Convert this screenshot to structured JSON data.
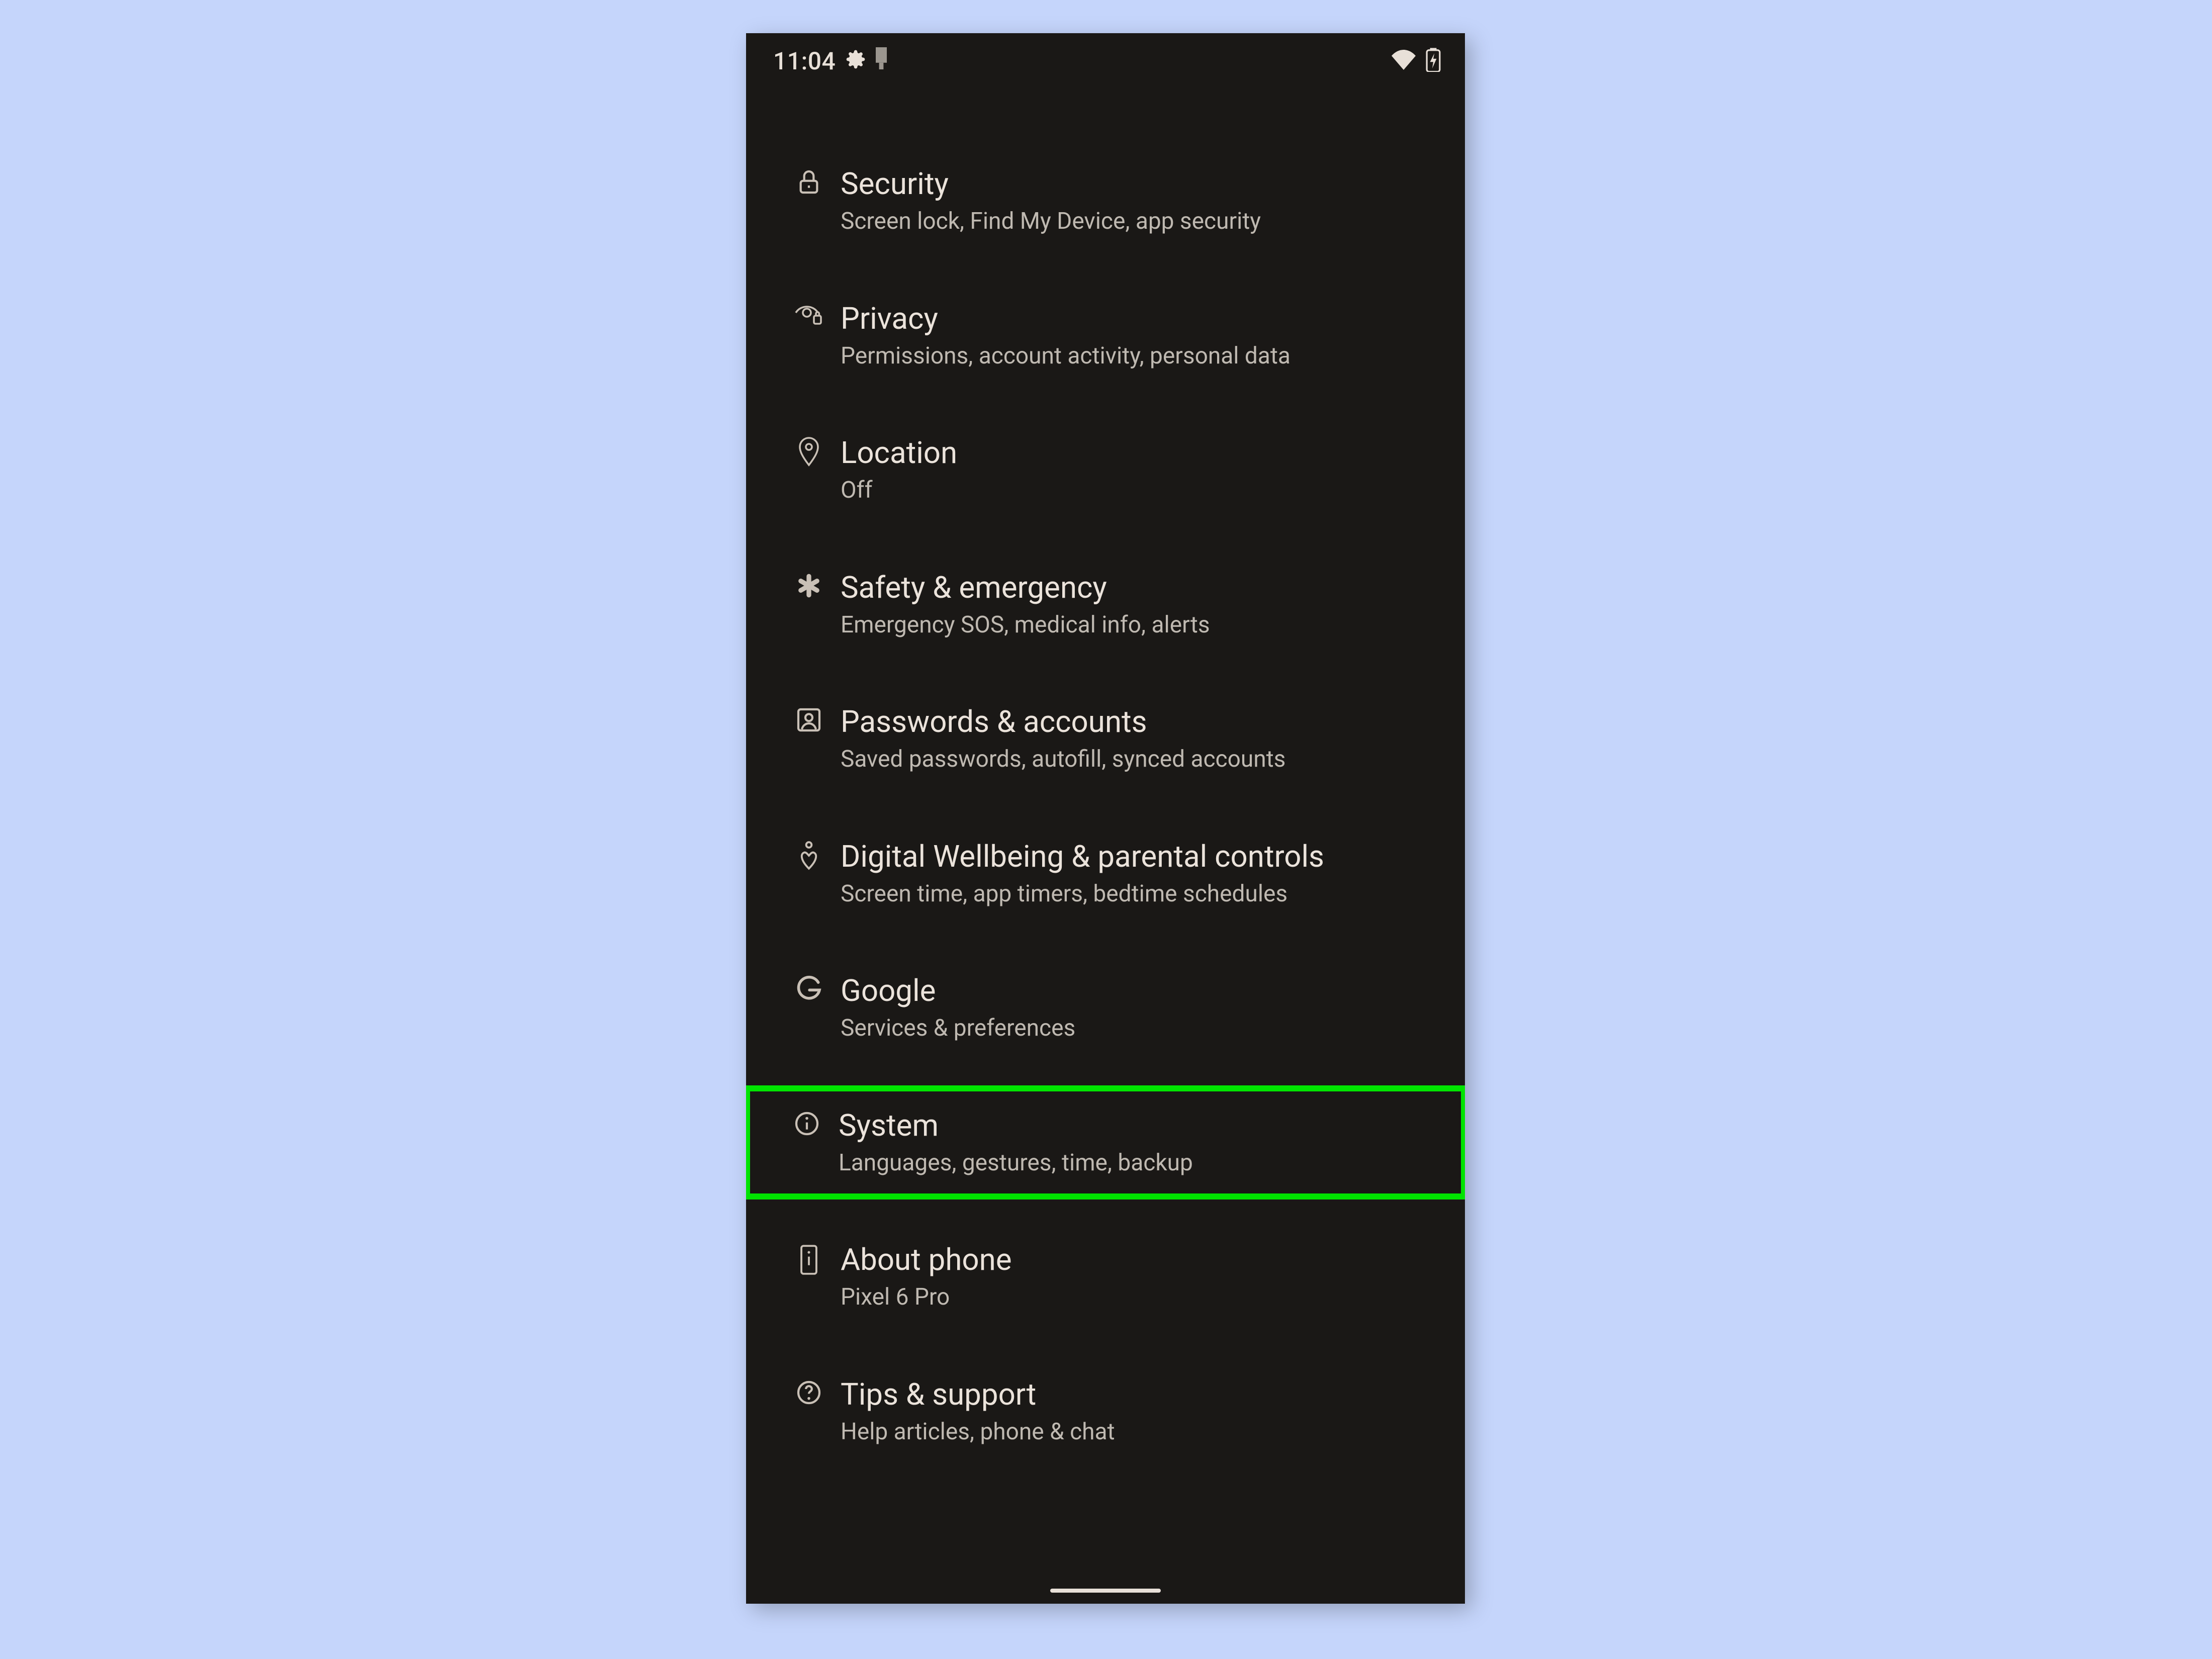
{
  "status": {
    "time": "11:04"
  },
  "items": [
    {
      "title": "Security",
      "subtitle": "Screen lock, Find My Device, app security"
    },
    {
      "title": "Privacy",
      "subtitle": "Permissions, account activity, personal data"
    },
    {
      "title": "Location",
      "subtitle": "Off"
    },
    {
      "title": "Safety & emergency",
      "subtitle": "Emergency SOS, medical info, alerts"
    },
    {
      "title": "Passwords & accounts",
      "subtitle": "Saved passwords, autofill, synced accounts"
    },
    {
      "title": "Digital Wellbeing & parental controls",
      "subtitle": "Screen time, app timers, bedtime schedules"
    },
    {
      "title": "Google",
      "subtitle": "Services & preferences"
    },
    {
      "title": "System",
      "subtitle": "Languages, gestures, time, backup"
    },
    {
      "title": "About phone",
      "subtitle": "Pixel 6 Pro"
    },
    {
      "title": "Tips & support",
      "subtitle": "Help articles, phone & chat"
    }
  ],
  "highlight_index": 7,
  "colors": {
    "bg": "#c5d5fb",
    "phone": "#1a1816",
    "title": "#ebe3db",
    "subtitle": "#bfb9b1",
    "icon": "#c9c0b6",
    "highlight": "#00e400"
  }
}
